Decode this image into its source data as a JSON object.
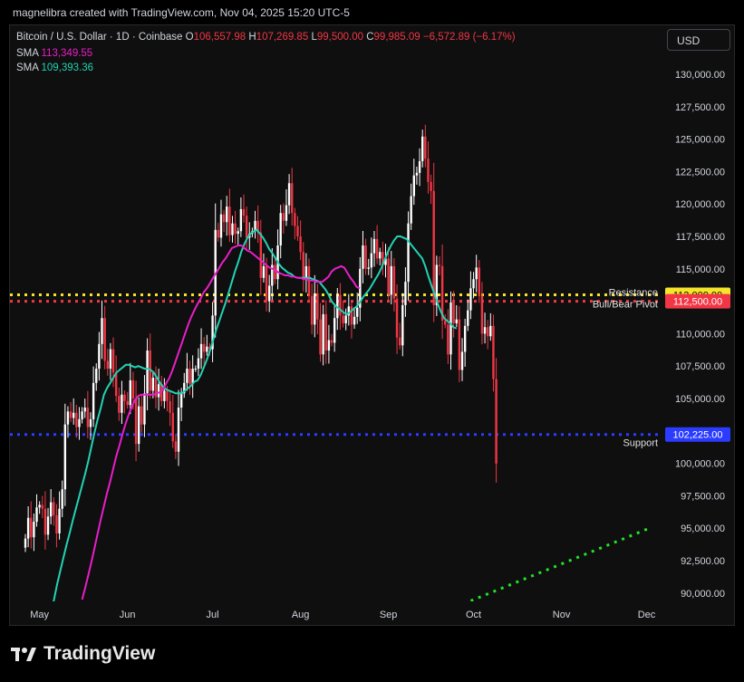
{
  "header": {
    "caption": "magnelibra created with TradingView.com, Nov 04, 2025 15:20 UTC-5"
  },
  "legend": {
    "symbol": "Bitcoin / U.S. Dollar · 1D · Coinbase",
    "o_label": "O",
    "o_value": "106,557.98",
    "h_label": "H",
    "h_value": "107,269.85",
    "l_label": "L",
    "l_value": "99,500.00",
    "c_label": "C",
    "c_value": "99,985.09",
    "change": "−6,572.89 (−6.17%)",
    "sma1_label": "SMA",
    "sma1_value": "113,349.55",
    "sma2_label": "SMA",
    "sma2_value": "109,393.36"
  },
  "currency_button": "USD",
  "brand": {
    "name": "TradingView",
    "logo_icon": "tradingview-logo-icon"
  },
  "colors": {
    "up": "#ffffff",
    "down": "#f23645",
    "sma_slow": "#e91ec8",
    "sma_fast": "#22d3b4",
    "resistance": "#f5e52a",
    "pivot": "#f23645",
    "support": "#2b3bff",
    "trend": "#22e22a"
  },
  "chart_data": {
    "type": "candlestick",
    "x_ticks": [
      "May",
      "Jun",
      "Jul",
      "Aug",
      "Sep",
      "Oct",
      "Nov",
      "Dec"
    ],
    "y_ticks": [
      "130,000.00",
      "127,500.00",
      "125,000.00",
      "122,500.00",
      "120,000.00",
      "117,500.00",
      "115,000.00",
      "112,500.00",
      "110,000.00",
      "107,500.00",
      "105,000.00",
      "102,500.00",
      "100,000.00",
      "97,500.00",
      "95,000.00",
      "92,500.00",
      "90,000.00"
    ],
    "ylim": [
      88900,
      132500
    ],
    "levels": [
      {
        "name": "Resistance",
        "value": 113000,
        "tag": "113,000.00",
        "color": "#f5e52a"
      },
      {
        "name": "Bull/Bear Pivot",
        "value": 112500,
        "tag": "112,500.00",
        "color": "#f23645"
      },
      {
        "name": "Support",
        "value": 102225,
        "tag": "102,225.00",
        "color": "#2b3bff"
      }
    ],
    "trendline": {
      "from": [
        "2025-09-30",
        89400
      ],
      "to": [
        "2025-12-02",
        95000
      ]
    },
    "candles_close": [
      94200,
      95800,
      94300,
      95500,
      96600,
      96800,
      96500,
      94500,
      95900,
      97000,
      96000,
      94600,
      96500,
      98000,
      103000,
      104000,
      103500,
      103900,
      102800,
      103400,
      104000,
      104300,
      102800,
      103400,
      106200,
      107300,
      109200,
      111200,
      107900,
      107300,
      108800,
      107000,
      105200,
      103900,
      105300,
      104800,
      104500,
      106400,
      105000,
      101500,
      104400,
      103000,
      105400,
      108700,
      105600,
      106600,
      105100,
      106100,
      104800,
      105600,
      104800,
      103900,
      101700,
      100900,
      104300,
      105400,
      106200,
      107300,
      106100,
      107300,
      107300,
      108100,
      109200,
      108600,
      109000,
      108800,
      111400,
      118000,
      117400,
      119200,
      118600,
      119800,
      117600,
      118500,
      117700,
      117900,
      119600,
      119100,
      117400,
      117700,
      117900,
      118700,
      117800,
      114300,
      115200,
      112500,
      113700,
      115300,
      114200,
      116800,
      119300,
      118700,
      119900,
      121600,
      119300,
      118300,
      117500,
      116300,
      114200,
      115200,
      112900,
      110700,
      113100,
      111100,
      108400,
      111500,
      108700,
      109500,
      109300,
      111200,
      113000,
      111400,
      110800,
      111400,
      112100,
      110700,
      111300,
      112000,
      115000,
      116800,
      115000,
      115100,
      116200,
      117300,
      115800,
      116300,
      115300,
      115800,
      113000,
      115200,
      112700,
      109700,
      109100,
      112200,
      114000,
      118500,
      120600,
      122200,
      122400,
      123300,
      125200,
      123500,
      121700,
      121000,
      112200,
      115300,
      115200,
      111000,
      110700,
      108400,
      112400,
      110800,
      111100,
      107200,
      108600,
      110600,
      111800,
      113500,
      114200,
      115100,
      112900,
      110000,
      110500,
      109800,
      110600,
      106500,
      99985
    ],
    "sma_fast_values": [
      88500,
      89500,
      90700,
      91700,
      92700,
      93700,
      94600,
      95600,
      96500,
      97400,
      98300,
      99200,
      100200,
      101300,
      102400,
      103400,
      104300,
      105300,
      105800,
      106200,
      106600,
      107000,
      107200,
      107400,
      107600,
      107600,
      107500,
      107400,
      107500,
      107400,
      107300,
      107300,
      107200,
      107000,
      106600,
      106200,
      105900,
      105700,
      105600,
      105500,
      105400,
      105400,
      105400,
      105600,
      105800,
      106000,
      106300,
      106400,
      106800,
      107400,
      108000,
      108700,
      109500,
      110300,
      111000,
      111700,
      112400,
      113200,
      114000,
      114800,
      115500,
      116300,
      116900,
      117400,
      117700,
      117900,
      118000,
      117700,
      117400,
      117000,
      116500,
      116200,
      115800,
      115400,
      115100,
      114900,
      114700,
      114600,
      114400,
      114300,
      114300,
      114300,
      114300,
      114300,
      114200,
      114100,
      114000,
      113700,
      113400,
      113000,
      112500,
      112200,
      112000,
      111800,
      111600,
      111500,
      111700,
      111900,
      112100,
      112400,
      112800,
      113100,
      113400,
      113800,
      114200,
      114600,
      115100,
      115700,
      116300,
      116800,
      117200,
      117500,
      117500,
      117400,
      117300,
      117000,
      116700,
      116400,
      116100,
      115800,
      115200,
      114400,
      113700,
      113000,
      112300,
      111700,
      111200,
      111000,
      110800,
      110500,
      110400
    ],
    "sma_slow_values": [
      89500,
      90400,
      91400,
      92400,
      93500,
      94600,
      95700,
      96700,
      97700,
      98600,
      99600,
      100600,
      101400,
      102300,
      103100,
      103800,
      104400,
      104900,
      105200,
      105300,
      105300,
      105300,
      105300,
      105300,
      105400,
      105500,
      105700,
      106200,
      106600,
      107200,
      107900,
      108600,
      109300,
      110000,
      110700,
      111300,
      111800,
      112300,
      112700,
      113200,
      113500,
      113900,
      114300,
      114700,
      115100,
      115500,
      115800,
      116200,
      116600,
      116700,
      116800,
      116800,
      116600,
      116400,
      116300,
      116100,
      115900,
      115700,
      115500,
      115300,
      115100,
      115000,
      114900,
      114700,
      114600,
      114500,
      114500,
      114400,
      114400,
      114300,
      114300,
      114200,
      114200,
      114100,
      114100,
      114000,
      114000,
      114000,
      114200,
      114400,
      114800,
      115000,
      115100,
      115200,
      115100,
      114700,
      114300,
      114000,
      113600,
      113500
    ]
  }
}
